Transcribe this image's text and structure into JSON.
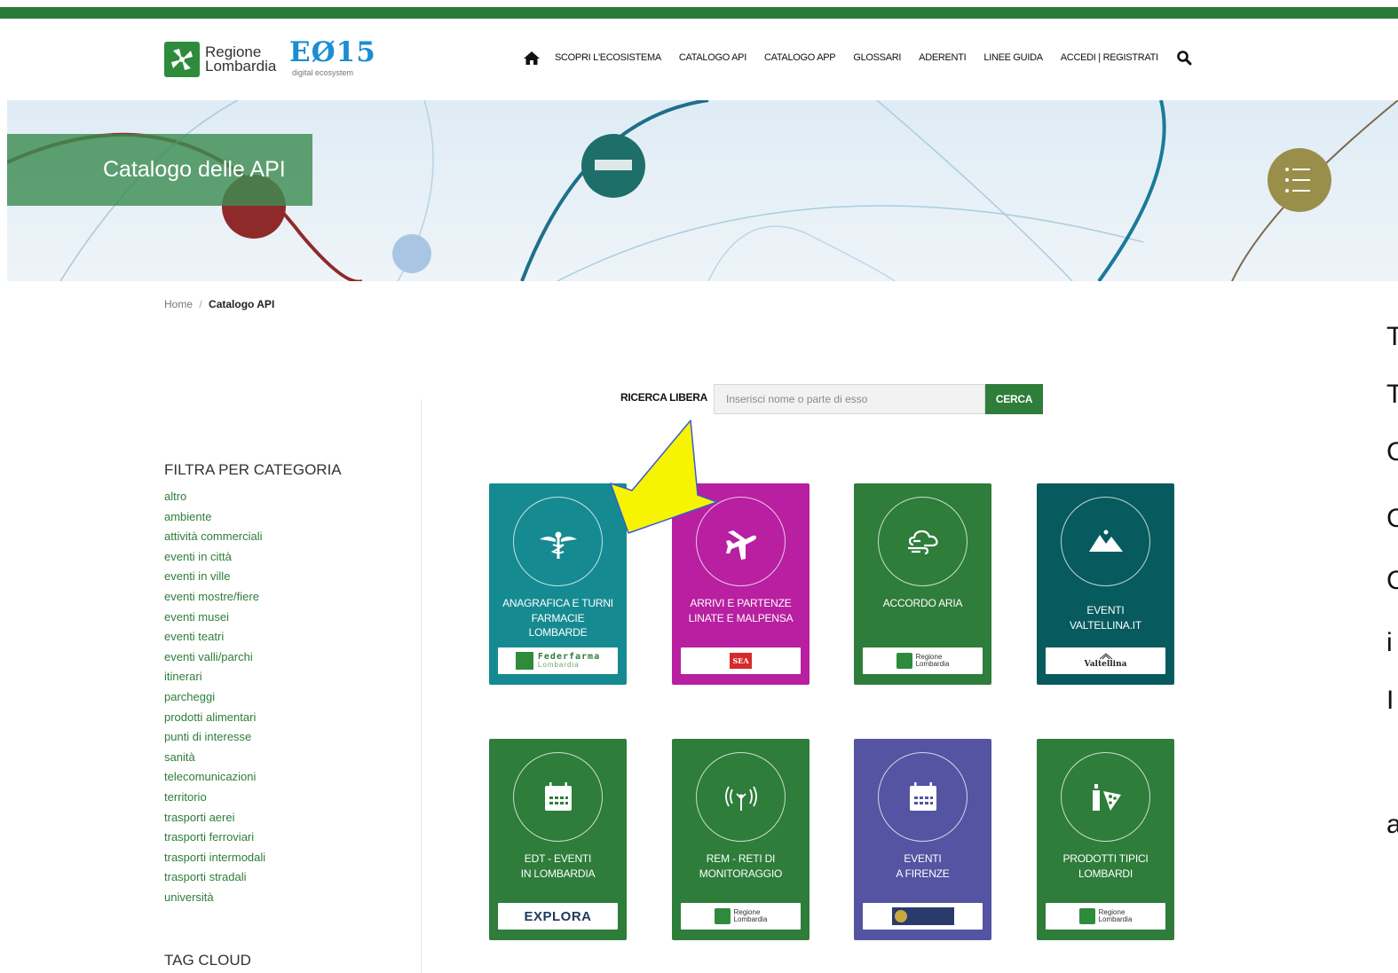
{
  "colors": {
    "top_bar": "#2c7a3a",
    "accent_green": "#2e7d3a",
    "eo_blue": "#1a8ed1",
    "card_teal": "#168a91",
    "card_magenta": "#b81fa1",
    "card_green": "#2e7d3a",
    "card_darkteal": "#075a5e",
    "card_purple": "#5454a2"
  },
  "header": {
    "logo_line1": "Regione",
    "logo_line2": "Lombardia",
    "logo2_big": "EØ15",
    "logo2_small": "digital ecosystem",
    "nav": [
      {
        "label": "SCOPRI L'ECOSISTEMA"
      },
      {
        "label": "CATALOGO API"
      },
      {
        "label": "CATALOGO APP"
      },
      {
        "label": "GLOSSARI"
      },
      {
        "label": "ADERENTI"
      },
      {
        "label": "LINEE GUIDA"
      },
      {
        "label": "ACCEDI | REGISTRATI"
      }
    ],
    "home_icon": "home-icon",
    "search_icon": "search-icon"
  },
  "banner": {
    "title": "Catalogo delle API"
  },
  "breadcrumb": {
    "home": "Home",
    "sep": "/",
    "current": "Catalogo API"
  },
  "search": {
    "label": "RICERCA LIBERA",
    "placeholder": "Inserisci nome o parte di esso",
    "button": "CERCA"
  },
  "sidebar": {
    "category_title": "FILTRA PER CATEGORIA",
    "categories": [
      "altro",
      "ambiente",
      "attività commerciali",
      "eventi in città",
      "eventi in ville",
      "eventi mostre/fiere",
      "eventi musei",
      "eventi teatri",
      "eventi valli/parchi",
      "itinerari",
      "parcheggi",
      "prodotti alimentari",
      "punti di interesse",
      "sanità",
      "telecomunicazioni",
      "territorio",
      "trasporti aerei",
      "trasporti ferroviari",
      "trasporti intermodali",
      "trasporti stradali",
      "università"
    ],
    "tag_title": "TAG CLOUD"
  },
  "cards": [
    {
      "line1": "ANAGRAFICA E TURNI",
      "line2": "FARMACIE",
      "line3": "LOMBARDE",
      "icon": "caduceus-icon",
      "logo_text": "Federfarma",
      "logo_sub": "Lombardia"
    },
    {
      "line1": "ARRIVI E PARTENZE",
      "line2": "LINATE E MALPENSA",
      "line3": "",
      "icon": "airplane-icon",
      "logo_text": "SEA",
      "logo_sub": ""
    },
    {
      "line1": "ACCORDO ARIA",
      "line2": "",
      "line3": "",
      "icon": "cloud-wind-icon",
      "logo_text": "Regione",
      "logo_sub": "Lombardia"
    },
    {
      "line1": "EVENTI",
      "line2": "VALTELLINA.IT",
      "line3": "",
      "icon": "mountain-icon",
      "logo_text": "Valtellina",
      "logo_sub": ""
    },
    {
      "line1": "EDT - EVENTI",
      "line2": "IN LOMBARDIA",
      "line3": "",
      "icon": "calendar-icon",
      "logo_text": "EXPLORA",
      "logo_sub": ""
    },
    {
      "line1": "REM - RETI DI",
      "line2": "MONITORAGGIO",
      "line3": "",
      "icon": "antenna-icon",
      "logo_text": "Regione",
      "logo_sub": "Lombardia"
    },
    {
      "line1": "EVENTI",
      "line2": "A FIRENZE",
      "line3": "",
      "icon": "calendar-icon",
      "logo_text": "",
      "logo_sub": ""
    },
    {
      "line1": "PRODOTTI TIPICI",
      "line2": "LOMBARDI",
      "line3": "",
      "icon": "food-icon",
      "logo_text": "Regione",
      "logo_sub": "Lombardia"
    }
  ],
  "right_clipped_letters": [
    "T",
    "T",
    "C",
    "C",
    "C",
    "i",
    "I",
    "a"
  ]
}
